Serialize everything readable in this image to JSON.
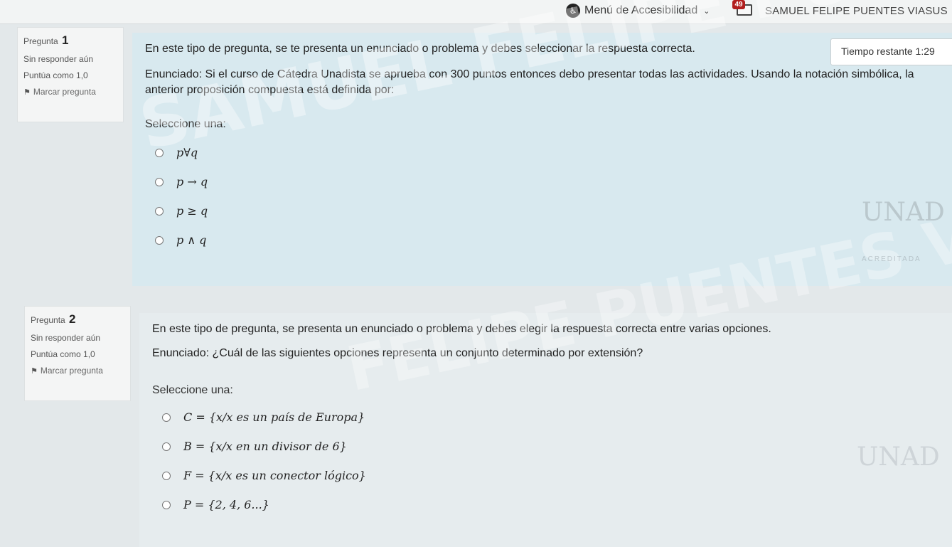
{
  "topbar": {
    "accessibility_label": "Menú de Accesibilidad",
    "message_count": "49",
    "user_name": "SAMUEL FELIPE PUENTES VIASUS"
  },
  "timer": {
    "text": "Tiempo restante 1:29"
  },
  "questions": [
    {
      "label": "Pregunta",
      "number": "1",
      "status": "Sin responder aún",
      "score": "Puntúa como 1,0",
      "flag": "Marcar pregunta",
      "intro": "En este tipo de pregunta, se te presenta un enunciado o problema y debes seleccionar la respuesta correcta.",
      "statement": "Enunciado: Si el curso de Cátedra Unadista se aprueba con 300 puntos entonces debo presentar todas las actividades. Usando la notación simbólica, la anterior proposición compuesta está definida por:",
      "select_label": "Seleccione una:",
      "options": [
        "p∀q",
        "p → q",
        "p ≥ q",
        "p ∧ q"
      ]
    },
    {
      "label": "Pregunta",
      "number": "2",
      "status": "Sin responder aún",
      "score": "Puntúa como 1,0",
      "flag": "Marcar pregunta",
      "intro": "En este tipo de pregunta, se presenta un enunciado o problema y debes elegir la respuesta correcta entre varias opciones.",
      "statement": "Enunciado: ¿Cuál de las siguientes opciones representa un conjunto determinado por extensión?",
      "select_label": "Seleccione una:",
      "options": [
        "C = {x/x es un país de Europa}",
        "B = {x/x en un divisor de 6}",
        "F = {x/x es un conector lógico}",
        "P = {2, 4, 6...}"
      ]
    }
  ],
  "watermark": {
    "line1": "SAMUEL FELIPE PUENTES VIASUS",
    "line2": "FELIPE PUENTES VIASUS"
  },
  "logo": {
    "text": "UNAD",
    "subtext": "ACREDITADA"
  }
}
